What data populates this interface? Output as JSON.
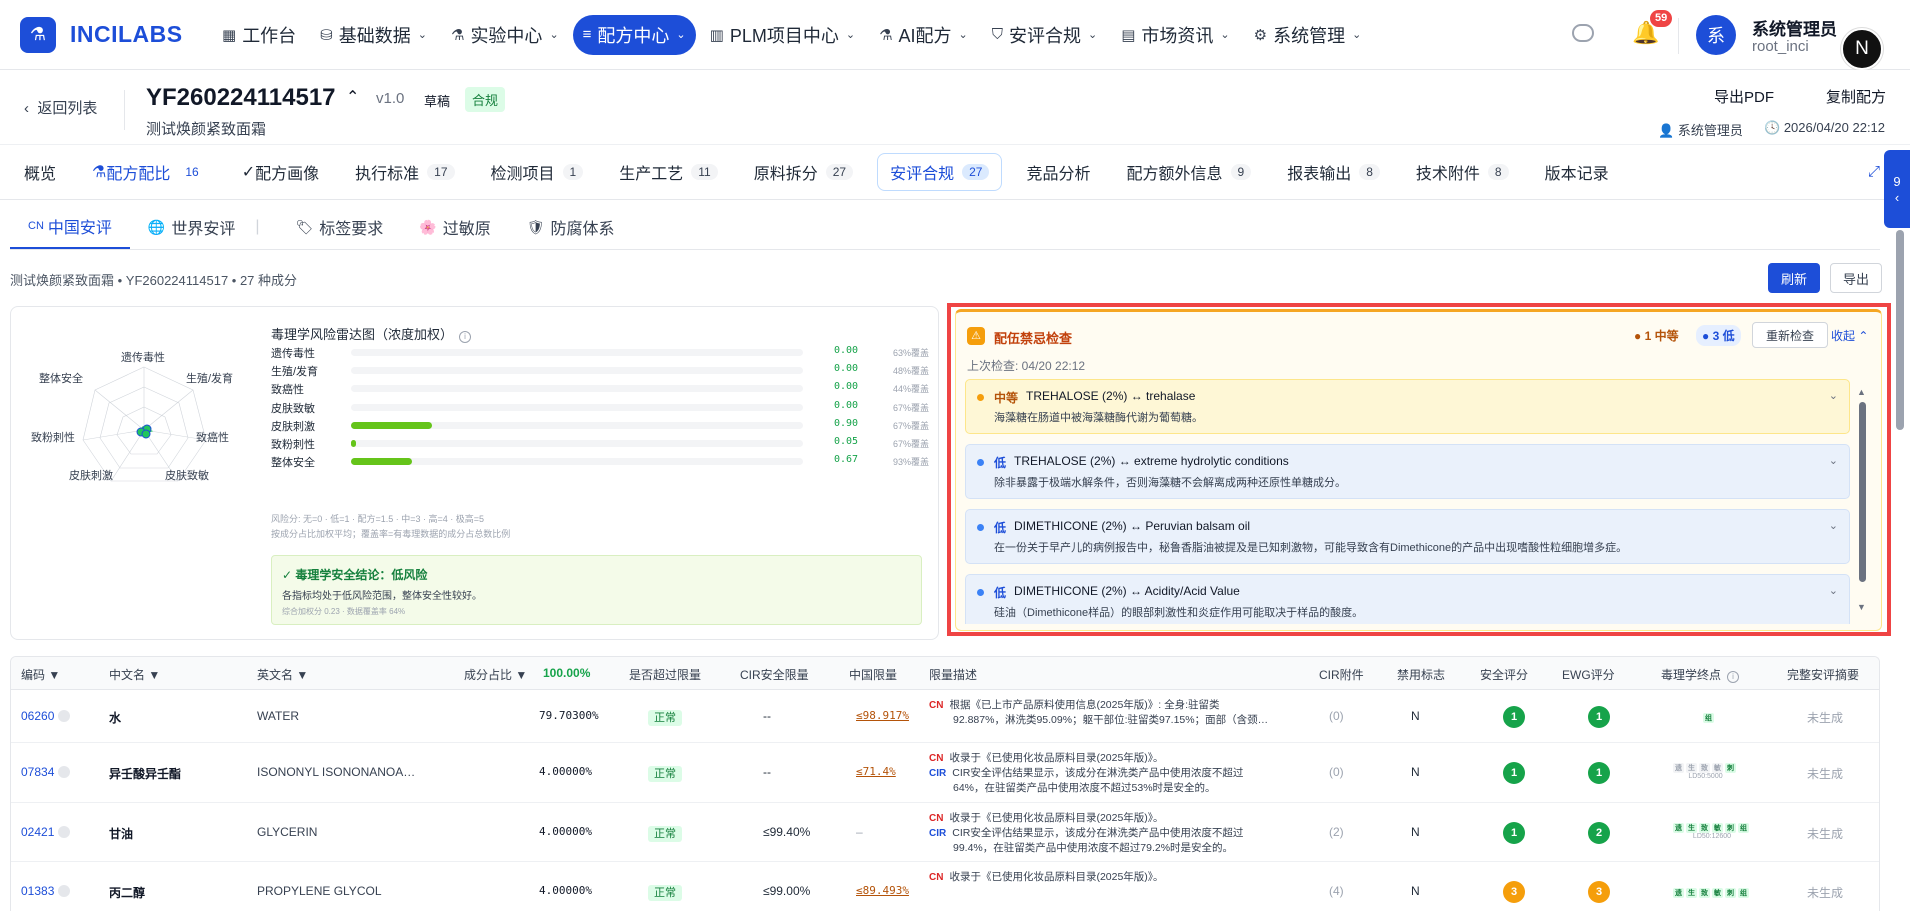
{
  "brand": {
    "logo_text": "INCILABS",
    "logo_icon": "flask-icon"
  },
  "nav": {
    "items": [
      {
        "label": "工作台",
        "icon": "grid-icon"
      },
      {
        "label": "基础数据",
        "icon": "database-icon"
      },
      {
        "label": "实验中心",
        "icon": "flask-icon"
      },
      {
        "label": "配方中心",
        "icon": "list-icon"
      },
      {
        "label": "PLM项目中心",
        "icon": "building-icon"
      },
      {
        "label": "AI配方",
        "icon": "flask-icon"
      },
      {
        "label": "安评合规",
        "icon": "shield-icon"
      },
      {
        "label": "市场资讯",
        "icon": "chart-icon"
      },
      {
        "label": "系统管理",
        "icon": "gear-icon"
      }
    ]
  },
  "topbar": {
    "notif_count": "59",
    "avatar_char": "系",
    "user_name": "系统管理员",
    "user_id": "root_inci",
    "n_badge": "N"
  },
  "header": {
    "back": "返回列表",
    "code": "YF260224114517",
    "version": "v1.0",
    "draft": "草稿",
    "compliance_tag": "合规",
    "name": "测试焕颜紧致面霜",
    "export_pdf": "导出PDF",
    "copy": "复制配方",
    "meta_user": "系统管理员",
    "meta_time": "2026/04/20 22:12"
  },
  "tabs": [
    {
      "label": "概览",
      "count": ""
    },
    {
      "label": "配方配比",
      "count": "16"
    },
    {
      "label": "配方画像",
      "count": ""
    },
    {
      "label": "执行标准",
      "count": "17"
    },
    {
      "label": "检测项目",
      "count": "1"
    },
    {
      "label": "生产工艺",
      "count": "11"
    },
    {
      "label": "原料拆分",
      "count": "27"
    },
    {
      "label": "安评合规",
      "count": "27"
    },
    {
      "label": "竞品分析",
      "count": ""
    },
    {
      "label": "配方额外信息",
      "count": "9"
    },
    {
      "label": "报表输出",
      "count": "8"
    },
    {
      "label": "技术附件",
      "count": "8"
    },
    {
      "label": "版本记录",
      "count": ""
    }
  ],
  "side_handle": {
    "count": "9"
  },
  "subtabs": [
    {
      "prefix": "CN",
      "label": "中国安评"
    },
    {
      "prefix": "🌐",
      "label": "世界安评"
    },
    {
      "prefix": "🏷",
      "label": "标签要求"
    },
    {
      "prefix": "🌸",
      "label": "过敏原"
    },
    {
      "prefix": "🛡",
      "label": "防腐体系"
    }
  ],
  "crumb": {
    "text": "测试焕颜紧致面霜 • YF260224114517 • 27 种成分",
    "refresh": "刷新",
    "export": "导出"
  },
  "radar": {
    "labels": [
      "遗传毒性",
      "生殖/发育",
      "致癌性",
      "皮肤致敏",
      "皮肤刺激",
      "致粉刺性",
      "整体安全"
    ]
  },
  "tox": {
    "title": "毒理学风险雷达图（浓度加权）",
    "rows": [
      {
        "name": "遗传毒性",
        "value": 0.0,
        "cov": "63%覆盖"
      },
      {
        "name": "生殖/发育",
        "value": 0.0,
        "cov": "48%覆盖"
      },
      {
        "name": "致癌性",
        "value": 0.0,
        "cov": "44%覆盖"
      },
      {
        "name": "皮肤致敏",
        "value": 0.0,
        "cov": "67%覆盖"
      },
      {
        "name": "皮肤刺激",
        "value": 0.9,
        "cov": "67%覆盖"
      },
      {
        "name": "致粉刺性",
        "value": 0.05,
        "cov": "67%覆盖"
      },
      {
        "name": "整体安全",
        "value": 0.67,
        "cov": "93%覆盖"
      }
    ],
    "note1": "风险分: 无=0 · 低=1 · 配方=1.5 · 中=3 · 高=4 · 极高=5",
    "note2": "按成分占比加权平均；覆盖率=有毒理数据的成分占总数比例",
    "conclusion_title": "✓ 毒理学安全结论：低风险",
    "conclusion_desc": "各指标均处于低风险范围，整体安全性较好。",
    "conclusion_meta": "综合加权分 0.23 · 数据覆盖率 64%"
  },
  "conflict": {
    "title": "配伍禁忌检查",
    "mid": "1 中等",
    "low": "3 低",
    "recheck": "重新检查",
    "collapse": "收起",
    "last": "上次检查: 04/20 22:12",
    "items": [
      {
        "level": "中等",
        "kind": "mid",
        "pair": "TREHALOSE (2%) ↔ trehalase",
        "desc": "海藻糖在肠道中被海藻糖酶代谢为葡萄糖。"
      },
      {
        "level": "低",
        "kind": "low",
        "pair": "TREHALOSE (2%) ↔ extreme hydrolytic conditions",
        "desc": "除非暴露于极端水解条件，否则海藻糖不会解离成两种还原性单糖成分。"
      },
      {
        "level": "低",
        "kind": "low",
        "pair": "DIMETHICONE (2%) ↔ Peruvian balsam oil",
        "desc": "在一份关于早产儿的病例报告中，秘鲁香脂油被提及是已知刺激物，可能导致含有Dimethicone的产品中出现嗜酸性粒细胞增多症。"
      },
      {
        "level": "低",
        "kind": "low",
        "pair": "DIMETHICONE (2%) ↔ Acidity/Acid Value",
        "desc": "硅油（Dimethicone样品）的眼部刺激性和炎症作用可能取决于样品的酸度。"
      }
    ]
  },
  "table": {
    "headers": {
      "code": "编码 ▼",
      "cname": "中文名 ▼",
      "ename": "英文名 ▼",
      "ratio": "成分占比 ▼",
      "ratio_total": "100.00%",
      "exceed": "是否超过限量",
      "cir": "CIR安全限量",
      "cnlim": "中国限量",
      "limdesc": "限量描述",
      "cirfile": "CIR附件",
      "ban": "禁用标志",
      "safe": "安全评分",
      "ewg": "EWG评分",
      "toxend": "毒理学终点",
      "summary": "完整安评摘要"
    },
    "rows": [
      {
        "code": "06260",
        "cname": "水",
        "ename": "WATER",
        "pct": "79.70300%",
        "status": "正常",
        "cir": "--",
        "cnlim": "≤98.917%",
        "desc": [
          {
            "tag": "CN",
            "text": "根据《已上市产品原料使用信息(2025年版)》: 全身:驻留类"
          },
          {
            "tag": "",
            "text": "92.887%，淋洗类95.09%；躯干部位:驻留类97.15%；面部（含颈…"
          }
        ],
        "cirfile": "(0)",
        "ban": "N",
        "safe": "1",
        "ewg": "1",
        "tox": [
          "组"
        ],
        "ld": "",
        "summary": "未生成"
      },
      {
        "code": "07834",
        "cname": "异壬酸异壬酯",
        "ename": "ISONONYL ISONONANOA…",
        "pct": "4.00000%",
        "status": "正常",
        "cir": "--",
        "cnlim": "≤71.4%",
        "desc": [
          {
            "tag": "CN",
            "text": "收录于《已使用化妆品原料目录(2025年版)》。"
          },
          {
            "tag": "CIR",
            "text": "CIR安全评估结果显示，该成分在淋洗类产品中使用浓度不超过"
          },
          {
            "tag": "",
            "text": "64%，在驻留类产品中使用浓度不超过53%时是安全的。"
          }
        ],
        "cirfile": "(0)",
        "ban": "N",
        "safe": "1",
        "ewg": "1",
        "tox": [
          "遗",
          "生",
          "致",
          "敏",
          "刺"
        ],
        "ld": "LD50:5000",
        "summary": "未生成"
      },
      {
        "code": "02421",
        "cname": "甘油",
        "ename": "GLYCERIN",
        "pct": "4.00000%",
        "status": "正常",
        "cir": "≤99.40%",
        "cnlim": "–",
        "desc": [
          {
            "tag": "CN",
            "text": "收录于《已使用化妆品原料目录(2025年版)》。"
          },
          {
            "tag": "CIR",
            "text": "CIR安全评估结果显示，该成分在淋洗类产品中使用浓度不超过"
          },
          {
            "tag": "",
            "text": "99.4%，在驻留类产品中使用浓度不超过79.2%时是安全的。"
          }
        ],
        "cirfile": "(2)",
        "ban": "N",
        "safe": "1",
        "ewg": "2",
        "tox": [
          "遗",
          "生",
          "致",
          "敏",
          "刺",
          "组"
        ],
        "ld": "LD50:12600",
        "summary": "未生成"
      },
      {
        "code": "01383",
        "cname": "丙二醇",
        "ename": "PROPYLENE GLYCOL",
        "pct": "4.00000%",
        "status": "正常",
        "cir": "≤99.00%",
        "cnlim": "≤89.493%",
        "desc": [
          {
            "tag": "CN",
            "text": "收录于《已使用化妆品原料目录(2025年版)》。"
          }
        ],
        "cirfile": "(4)",
        "ban": "N",
        "safe": "3",
        "ewg": "3",
        "tox": [
          "遗",
          "生",
          "致",
          "敏",
          "刺",
          "组"
        ],
        "ld": "",
        "summary": "未生成"
      }
    ]
  },
  "colors": {
    "primary": "#1d4ed8",
    "warning": "#f59e0b",
    "success": "#16a34a",
    "danger": "#ef4444"
  }
}
